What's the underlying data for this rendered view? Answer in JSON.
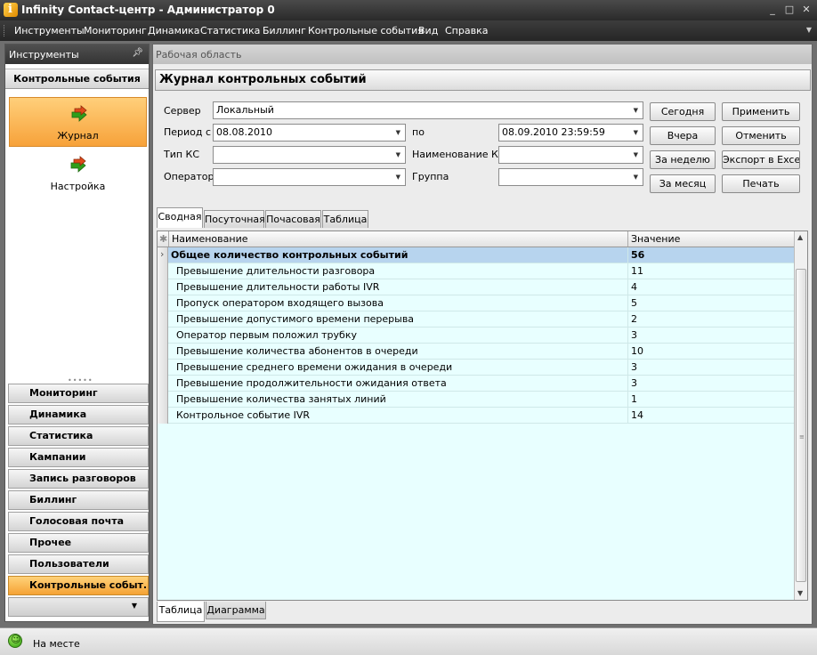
{
  "window": {
    "title": "Infinity Contact-центр - Администратор 0"
  },
  "menu": [
    "Инструменты",
    "Мониторинг",
    "Динамика",
    "Статистика",
    "Биллинг",
    "Контрольные события",
    "Вид",
    "Справка"
  ],
  "left_panel": {
    "header": "Инструменты",
    "section": "Контрольные события",
    "tiles": [
      {
        "label": "Журнал",
        "icon": "arrows-icon",
        "active": true
      },
      {
        "label": "Настройка",
        "icon": "arrows-icon",
        "active": false
      }
    ],
    "nav": [
      {
        "label": "Мониторинг",
        "active": false
      },
      {
        "label": "Динамика",
        "active": false
      },
      {
        "label": "Статистика",
        "active": false
      },
      {
        "label": "Кампании",
        "active": false
      },
      {
        "label": "Запись разговоров",
        "active": false
      },
      {
        "label": "Биллинг",
        "active": false
      },
      {
        "label": "Голосовая почта",
        "active": false
      },
      {
        "label": "Прочее",
        "active": false
      },
      {
        "label": "Пользователи",
        "active": false
      },
      {
        "label": "Контрольные событ...",
        "active": true
      }
    ]
  },
  "workarea": {
    "header": "Рабочая область",
    "title": "Журнал контрольных событий"
  },
  "filters": {
    "server_label": "Сервер",
    "server_value": "Локальный",
    "period_label": "Период с",
    "period_from": "08.08.2010",
    "period_to_label": "по",
    "period_to": "08.09.2010 23:59:59",
    "type_label": "Тип КС",
    "type_value": "",
    "name_label": "Наименование КС",
    "name_value": "",
    "operator_label": "Оператор",
    "operator_value": "",
    "group_label": "Группа",
    "group_value": ""
  },
  "buttons": {
    "today": "Сегодня",
    "yesterday": "Вчера",
    "week": "За неделю",
    "month": "За месяц",
    "apply": "Применить",
    "cancel": "Отменить",
    "export": "Экспорт в Excel",
    "print": "Печать"
  },
  "tabs": [
    "Сводная",
    "Посуточная",
    "Почасовая",
    "Таблица"
  ],
  "table": {
    "headers": [
      "Наименование",
      "Значение"
    ],
    "rows": [
      {
        "name": "Общее количество контрольных событий",
        "value": "56",
        "selected": true
      },
      {
        "name": "Превышение длительности разговора",
        "value": "11"
      },
      {
        "name": "Превышение длительности работы IVR",
        "value": "4"
      },
      {
        "name": "Пропуск оператором входящего вызова",
        "value": "5"
      },
      {
        "name": "Превышение допустимого времени перерыва",
        "value": "2"
      },
      {
        "name": "Оператор первым положил трубку",
        "value": "3"
      },
      {
        "name": "Превышение количества абонентов в очереди",
        "value": "10"
      },
      {
        "name": "Превышение среднего времени ожидания в очереди",
        "value": "3"
      },
      {
        "name": "Превышение продолжительности ожидания ответа",
        "value": "3"
      },
      {
        "name": "Превышение количества занятых линий",
        "value": "1"
      },
      {
        "name": "Контрольное событие IVR",
        "value": "14"
      }
    ]
  },
  "bottom_tabs": [
    "Таблица",
    "Диаграмма"
  ],
  "status": {
    "text": "На месте"
  }
}
